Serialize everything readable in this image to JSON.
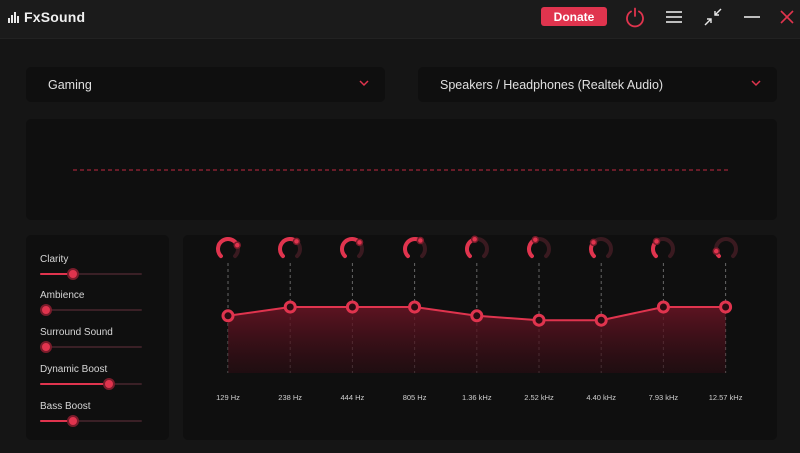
{
  "app": {
    "name": "FxSound"
  },
  "toolbar": {
    "donate_label": "Donate",
    "icons": [
      "power-icon",
      "menu-icon",
      "minimize-view-icon",
      "minimize-icon",
      "close-icon"
    ]
  },
  "preset": {
    "selected": "Gaming"
  },
  "output_device": {
    "selected": "Speakers / Headphones (Realtek Audio)"
  },
  "effects": [
    {
      "label": "Clarity",
      "value": 0.3
    },
    {
      "label": "Ambience",
      "value": 0.0
    },
    {
      "label": "Surround Sound",
      "value": 0.0
    },
    {
      "label": "Dynamic Boost",
      "value": 0.7
    },
    {
      "label": "Bass Boost",
      "value": 0.3
    }
  ],
  "eq": {
    "bands": [
      "129 Hz",
      "238 Hz",
      "444 Hz",
      "805 Hz",
      "1.36 kHz",
      "2.52 kHz",
      "4.40 kHz",
      "7.93 kHz",
      "12.57 kHz"
    ],
    "levels": [
      0.52,
      0.6,
      0.6,
      0.6,
      0.52,
      0.48,
      0.48,
      0.6,
      0.6
    ],
    "knob_fraction": [
      0.75,
      0.65,
      0.68,
      0.62,
      0.45,
      0.42,
      0.32,
      0.35,
      0.12
    ]
  },
  "colors": {
    "accent": "#e0344e",
    "background": "#151515",
    "panel": "#0f0f0f"
  }
}
